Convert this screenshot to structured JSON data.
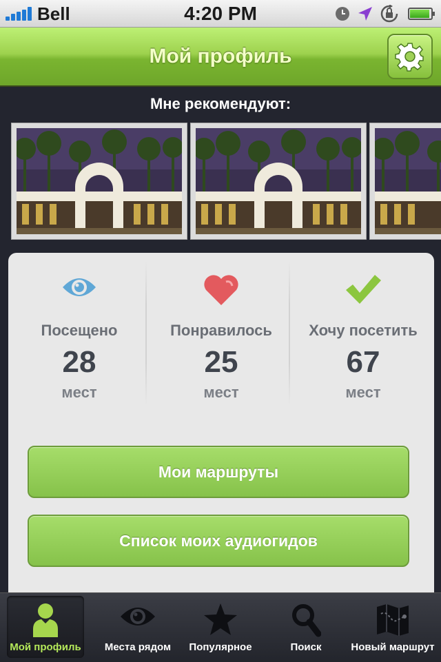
{
  "status_bar": {
    "carrier": "Bell",
    "time": "4:20 PM",
    "icons": [
      "signal-bars-icon",
      "clock-icon",
      "location-arrow-icon",
      "rotation-lock-icon",
      "battery-icon"
    ],
    "battery_level": 0.85
  },
  "nav": {
    "title": "Мой профиль",
    "settings_icon": "gear-icon"
  },
  "recommendations": {
    "title": "Мне рекомендуют:",
    "photos": [
      {
        "icon": "park-arch-photo"
      },
      {
        "icon": "park-arch-photo"
      },
      {
        "icon": "park-arch-photo"
      }
    ]
  },
  "stats": [
    {
      "icon": "eye-icon",
      "label": "Посещено",
      "value": "28",
      "unit": "мест",
      "color": "#5fa7d6"
    },
    {
      "icon": "heart-icon",
      "label": "Понравилось",
      "value": "25",
      "unit": "мест",
      "color": "#e35a5e"
    },
    {
      "icon": "checkmark-icon",
      "label": "Хочу посетить",
      "value": "67",
      "unit": "мест",
      "color": "#8cc63f"
    }
  ],
  "buttons": {
    "routes": "Мои маршруты",
    "audioguides": "Список моих аудиогидов"
  },
  "tabbar": {
    "active_index": 0,
    "accent_color": "#b4e85a",
    "items": [
      {
        "label": "Мой профиль",
        "icon": "user-icon"
      },
      {
        "label": "Места рядом",
        "icon": "eye-icon"
      },
      {
        "label": "Популярное",
        "icon": "star-icon"
      },
      {
        "label": "Поиск",
        "icon": "search-icon"
      },
      {
        "label": "Новый маршрут",
        "icon": "map-icon"
      }
    ]
  }
}
